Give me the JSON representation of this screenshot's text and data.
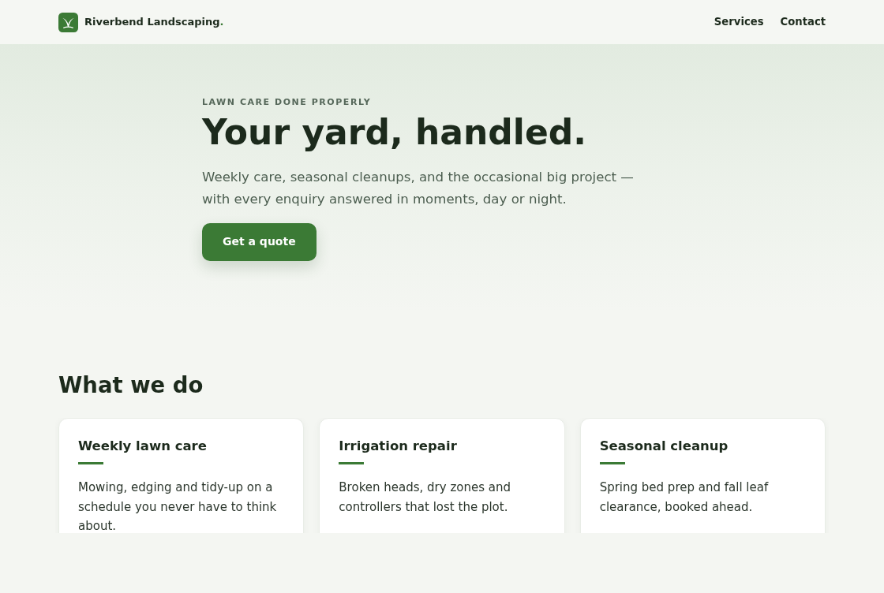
{
  "nav": {
    "brand": {
      "name": "Riverbend Landscaping",
      "accent": "."
    },
    "links": [
      {
        "label": "Services"
      },
      {
        "label": "Contact"
      }
    ]
  },
  "hero": {
    "eyebrow": "LAWN CARE DONE PROPERLY",
    "title": "Your yard, handled.",
    "lead": "Weekly care, seasonal cleanups, and the occasional big project — with every enquiry answered in moments, day or night.",
    "button": "Get a quote"
  },
  "services": {
    "heading": "What we do",
    "cards": [
      {
        "title": "Weekly lawn care",
        "text": "Mowing, edging and tidy-up on a schedule you never have to think about."
      },
      {
        "title": "Irrigation repair",
        "text": "Broken heads, dry zones and controllers that lost the plot."
      },
      {
        "title": "Seasonal cleanup",
        "text": "Spring bed prep and fall leaf clearance, booked ahead."
      }
    ]
  }
}
